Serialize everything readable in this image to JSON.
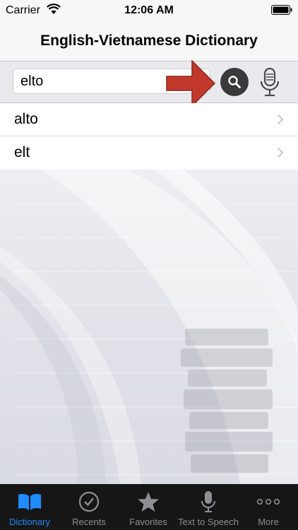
{
  "status_bar": {
    "carrier": "Carrier",
    "time": "12:06 AM"
  },
  "nav": {
    "title": "English-Vietnamese Dictionary"
  },
  "search": {
    "value": "elto"
  },
  "results": [
    {
      "word": "alto"
    },
    {
      "word": "elt"
    }
  ],
  "tabs": [
    {
      "label": "Dictionary",
      "icon": "book-icon",
      "active": true
    },
    {
      "label": "Recents",
      "icon": "clock-icon",
      "active": false
    },
    {
      "label": "Favorites",
      "icon": "star-icon",
      "active": false
    },
    {
      "label": "Text to Speech",
      "icon": "microphone-icon",
      "active": false
    },
    {
      "label": "More",
      "icon": "more-dots-icon",
      "active": false
    }
  ],
  "colors": {
    "accent": "#1e8cff",
    "tab_bar": "#161616",
    "annotation_arrow": "#c0392b"
  }
}
